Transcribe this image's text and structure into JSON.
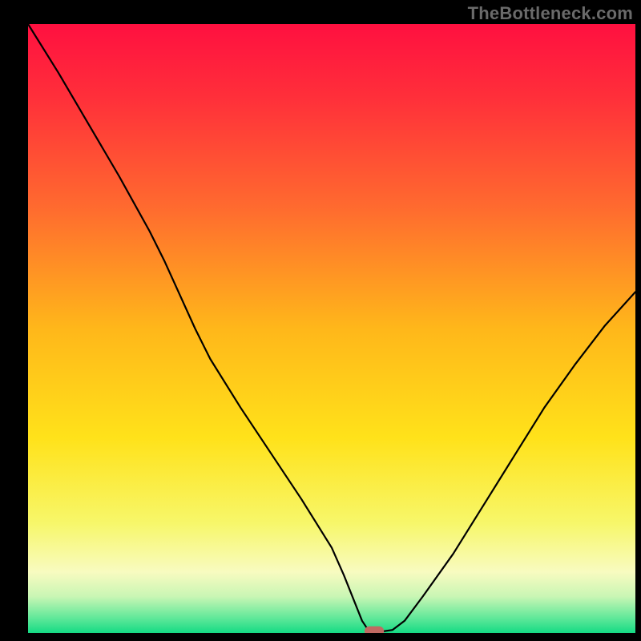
{
  "watermark": "TheBottleneck.com",
  "chart_data": {
    "type": "line",
    "title": "",
    "xlabel": "",
    "ylabel": "",
    "xlim": [
      0,
      100
    ],
    "ylim": [
      0,
      100
    ],
    "grid": false,
    "legend": false,
    "series": [
      {
        "name": "curve",
        "x": [
          0,
          5,
          10,
          15,
          20,
          22.5,
          25,
          27.5,
          30,
          35,
          40,
          45,
          50,
          52,
          54,
          55,
          56,
          58,
          60,
          62,
          65,
          70,
          75,
          80,
          85,
          90,
          95,
          100
        ],
        "y": [
          100,
          92,
          83.5,
          75,
          66,
          61,
          55.5,
          50,
          45,
          37,
          29.5,
          22,
          14,
          9.5,
          4.5,
          2,
          0.5,
          0.2,
          0.5,
          2,
          6,
          13,
          21,
          29,
          37,
          44,
          50.5,
          56
        ]
      }
    ],
    "marker": {
      "x": 57,
      "y": 0.3,
      "w": 3.2,
      "h": 1.6
    },
    "gradient_stops": [
      {
        "offset": 0.0,
        "color": "#ff1040"
      },
      {
        "offset": 0.12,
        "color": "#ff2f3a"
      },
      {
        "offset": 0.3,
        "color": "#ff6a2f"
      },
      {
        "offset": 0.5,
        "color": "#ffb71a"
      },
      {
        "offset": 0.68,
        "color": "#ffe21a"
      },
      {
        "offset": 0.82,
        "color": "#f7f76a"
      },
      {
        "offset": 0.9,
        "color": "#f8fbc0"
      },
      {
        "offset": 0.94,
        "color": "#c9f6b4"
      },
      {
        "offset": 0.975,
        "color": "#62e89a"
      },
      {
        "offset": 1.0,
        "color": "#15db84"
      }
    ]
  }
}
